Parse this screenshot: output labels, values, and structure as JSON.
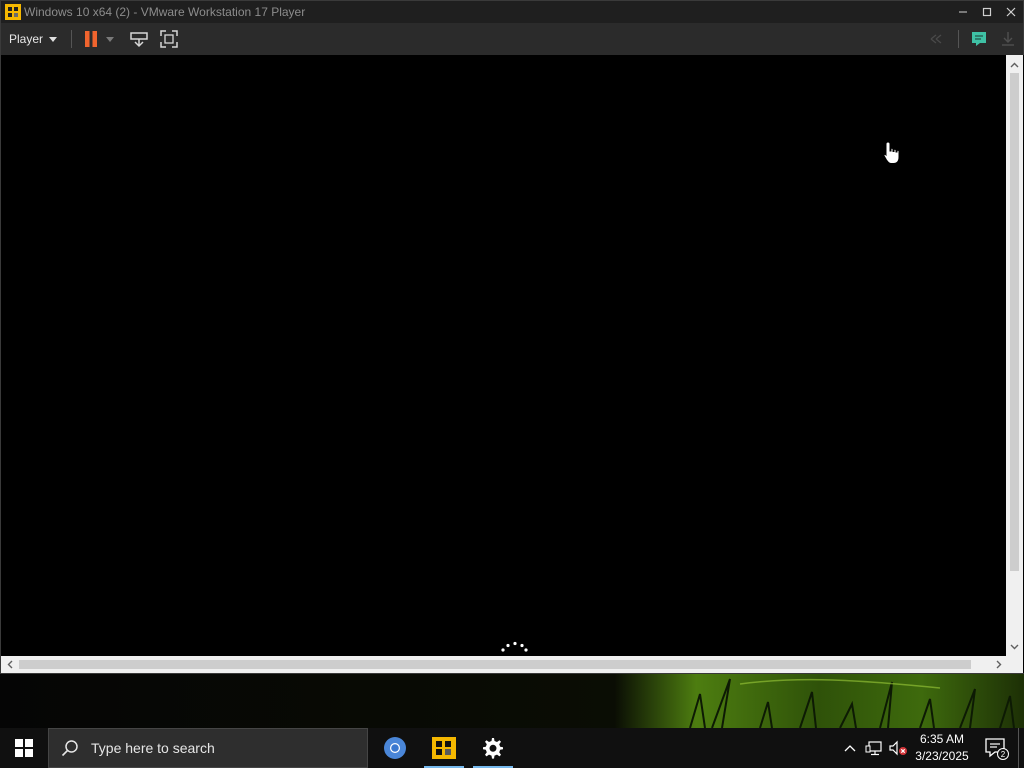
{
  "window": {
    "title": "Windows 10 x64 (2) - VMware Workstation 17 Player",
    "controls": {
      "minimize": "–",
      "maximize": "☐",
      "close": "✕"
    }
  },
  "toolbar": {
    "player_label": "Player",
    "icons": [
      "pause-icon",
      "dropdown-arrow-icon",
      "send-ctrl-alt-del-icon",
      "fullscreen-icon",
      "unity-icon",
      "message-log-icon",
      "download-icon"
    ]
  },
  "vm_display": {
    "state": "booting"
  },
  "taskbar": {
    "search_placeholder": "Type here to search",
    "pinned_apps": [
      "chrome-icon",
      "vmware-player-icon",
      "settings-icon"
    ],
    "clock_time": "6:35 AM",
    "clock_date": "3/23/2025",
    "notification_count": "2"
  },
  "colors": {
    "pause_orange": "#f0642e",
    "vmware_yellow": "#f5b800",
    "taskbar_accent": "#76b9ed",
    "log_teal": "#3fc1a5"
  }
}
